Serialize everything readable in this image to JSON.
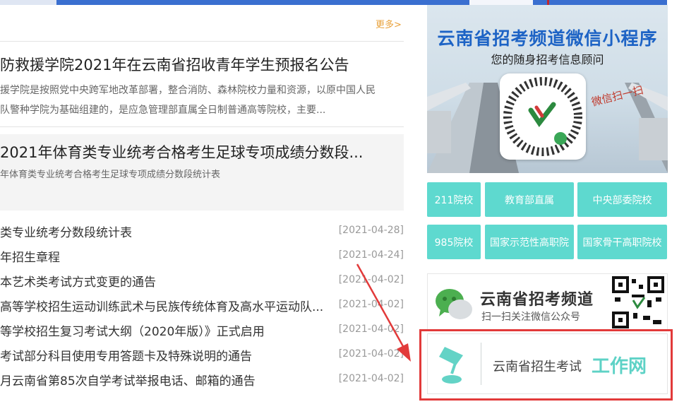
{
  "header": {
    "more_link": "更多>"
  },
  "featured": [
    {
      "title": "防救援学院2021年在云南省招收青年学生预报名公告",
      "desc_lines": [
        "援学院是按照党中央跨军地改革部署，整合消防、森林院校力量和资源，以原中国人民",
        "队警种学院为基础组建的，是应急管理部直属全日制普通高等院校，主要..."
      ]
    },
    {
      "title": "2021年体育类专业统考合格考生足球专项成绩分数段...",
      "desc": "年体育类专业统考合格考生足球专项成绩分数段统计表"
    }
  ],
  "news_list": [
    {
      "title": "类专业统考分数段统计表",
      "date": "[2021-04-28]"
    },
    {
      "title": "年招生章程",
      "date": "[2021-04-24]"
    },
    {
      "title": "本艺术类考试方式变更的通告",
      "date": "[2021-04-02]"
    },
    {
      "title": "高等学校招生运动训练武术与民族传统体育及高水平运动队...",
      "date": "[2021-04-02]"
    },
    {
      "title": "等学校招生复习考试大纲（2020年版）》正式启用",
      "date": "[2021-04-02]"
    },
    {
      "title": "考试部分科目使用专用答题卡及特殊说明的通告",
      "date": "[2021-04-02]"
    },
    {
      "title": "月云南省第85次自学考试举报电话、邮箱的通告",
      "date": "[2021-04-02]"
    }
  ],
  "promo": {
    "title": "云南省招考频道微信小程序",
    "subtitle": "您的随身招考信息顾问",
    "scan_text": "微信扫一扫"
  },
  "categories": [
    "211院校",
    "教育部直属",
    "中央部委院校",
    "985院校",
    "国家示范性高职院",
    "国家骨干高职院校"
  ],
  "wechat": {
    "title": "云南省招考频道",
    "subtitle": "扫一扫关注微信公众号"
  },
  "work": {
    "title": "云南省招生考试",
    "brand": "工作网"
  },
  "colors": {
    "teal": "#5ed9cf",
    "orange": "#e8a13a",
    "highlight_red": "#e23a3a",
    "promo_blue": "#1d63c5"
  }
}
